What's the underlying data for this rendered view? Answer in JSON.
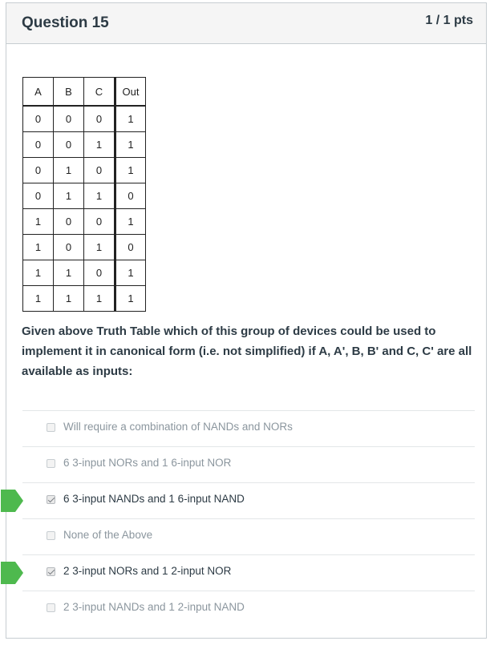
{
  "question": {
    "title": "Question 15",
    "points": "1 / 1 pts",
    "prompt": "Given above Truth Table which of this group of devices could be used to implement it  in canonical form (i.e. not simplified) if A, A', B, B' and C, C' are all available as inputs:"
  },
  "truth_table": {
    "headers": [
      "A",
      "B",
      "C",
      "Out"
    ],
    "rows": [
      [
        "0",
        "0",
        "0",
        "1"
      ],
      [
        "0",
        "0",
        "1",
        "1"
      ],
      [
        "0",
        "1",
        "0",
        "1"
      ],
      [
        "0",
        "1",
        "1",
        "0"
      ],
      [
        "1",
        "0",
        "0",
        "1"
      ],
      [
        "1",
        "0",
        "1",
        "0"
      ],
      [
        "1",
        "1",
        "0",
        "1"
      ],
      [
        "1",
        "1",
        "1",
        "1"
      ]
    ]
  },
  "answers": [
    {
      "label": "Will require a combination of NANDs and NORs",
      "checked": false,
      "correct": false
    },
    {
      "label": "6 3-input NORs and 1 6-input NOR",
      "checked": false,
      "correct": false
    },
    {
      "label": "6 3-input NANDs and 1 6-input NAND",
      "checked": true,
      "correct": true
    },
    {
      "label": "None of the Above",
      "checked": false,
      "correct": false
    },
    {
      "label": "2 3-input NORs and 1 2-input NOR",
      "checked": true,
      "correct": true
    },
    {
      "label": "2 3-input NANDs and 1 2-input NAND",
      "checked": false,
      "correct": false
    }
  ],
  "colors": {
    "correct_marker": "#4eb94e",
    "header_bg": "#f5f5f5",
    "text": "#2d3b45",
    "muted_text": "#8b969e"
  },
  "icons": {
    "correct_marker": "correct-answer-arrow-icon",
    "checkbox": "checkbox-icon"
  }
}
